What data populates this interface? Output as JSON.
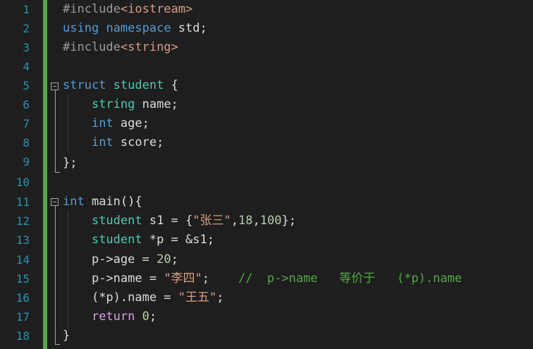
{
  "editor": {
    "line_numbers": [
      "1",
      "2",
      "3",
      "4",
      "5",
      "6",
      "7",
      "8",
      "9",
      "10",
      "11",
      "12",
      "13",
      "14",
      "15",
      "16",
      "17",
      "18"
    ],
    "code": {
      "l1": {
        "directive": "#include",
        "header": "<iostream>"
      },
      "l2": {
        "kw1": "using",
        "kw2": "namespace",
        "rest": " std;"
      },
      "l3": {
        "directive": "#include",
        "header": "<string>"
      },
      "l5": {
        "kw": "struct",
        "type": "student",
        "rest": " {"
      },
      "l6": {
        "type": "string",
        "rest": " name;"
      },
      "l7": {
        "kw": "int",
        "rest": " age;"
      },
      "l8": {
        "kw": "int",
        "rest": " score;"
      },
      "l9": {
        "text": "};"
      },
      "l11": {
        "kw": "int",
        "rest": " main(){"
      },
      "l12": {
        "type": "student",
        "p1": " s1 = {",
        "str": "\"张三\"",
        "p2": ",",
        "n1": "18",
        "p3": ",",
        "n2": "100",
        "p4": "};"
      },
      "l13": {
        "type": "student",
        "p1": " *p = &s1;"
      },
      "l14": {
        "p1": "p->age = ",
        "num": "20",
        "p2": ";"
      },
      "l15": {
        "p1": "p->name = ",
        "str": "\"李四\"",
        "p2": ";    ",
        "comment": "//  p->name   等价于   (*p).name"
      },
      "l16": {
        "p1": "(*p).name = ",
        "str": "\"王五\"",
        "p2": ";"
      },
      "l17": {
        "kw": "return",
        "p1": " ",
        "num": "0",
        "p2": ";"
      },
      "l18": {
        "text": "}"
      }
    }
  }
}
